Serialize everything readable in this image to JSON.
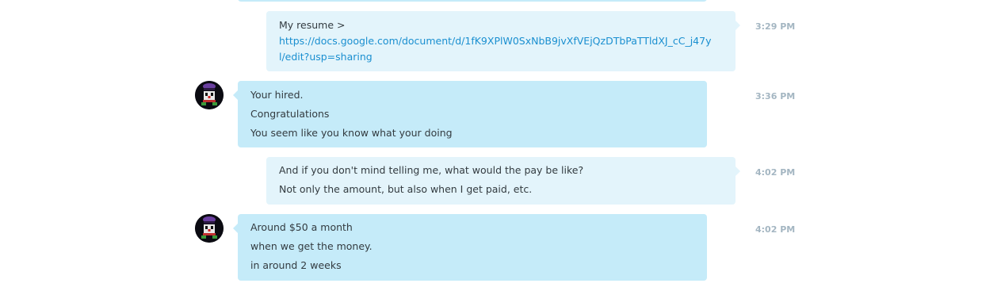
{
  "messages": [
    {
      "id": "m1",
      "direction": "outgoing",
      "lines": [
        "My resume >"
      ],
      "link": "https://docs.google.com/document/d/1fK9XPlW0SxNbB9jvXfVEjQzDTbPaTTldXJ_cC_j47yl/edit?usp=sharing",
      "time": "3:29 PM"
    },
    {
      "id": "m2",
      "direction": "incoming",
      "lines": [
        "Your hired.",
        "Congratulations",
        "You seem like you know what your doing"
      ],
      "time": "3:36 PM"
    },
    {
      "id": "m3",
      "direction": "outgoing",
      "lines": [
        "And if you don't mind telling me, what would the pay be like?",
        "Not only the amount, but also when I get paid, etc."
      ],
      "time": "4:02 PM"
    },
    {
      "id": "m4",
      "direction": "incoming",
      "lines": [
        "Around $50 a month",
        "when we get the money.",
        "in around 2 weeks"
      ],
      "time": "4:02 PM"
    }
  ],
  "colors": {
    "incoming_bubble": "#c5ebf9",
    "outgoing_bubble": "#e3f4fb",
    "link": "#1a8fd0",
    "timestamp": "#a4b6c2",
    "text": "#333b40"
  },
  "icons": {
    "avatar": "clown-face-avatar"
  }
}
